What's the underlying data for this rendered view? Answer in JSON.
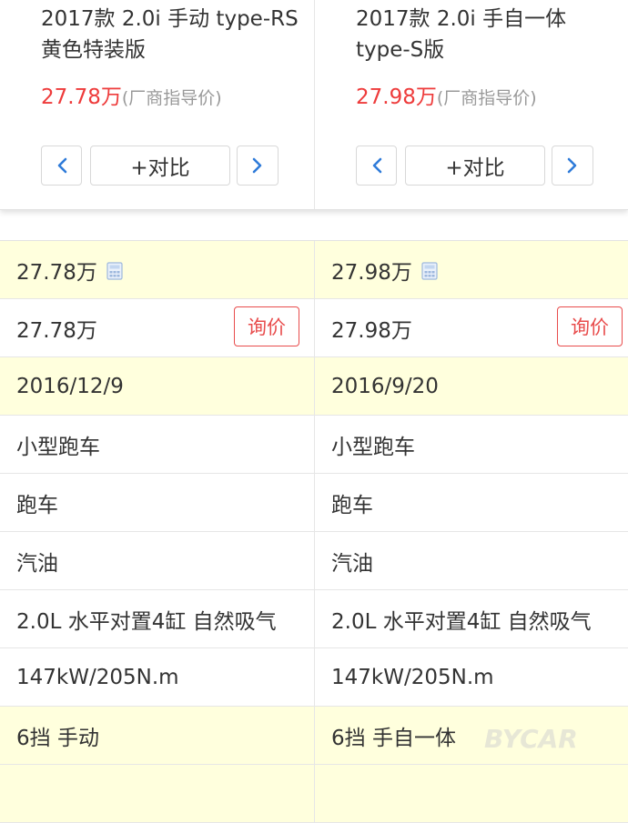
{
  "cars": [
    {
      "name": "2017款 2.0i 手动 type-RS黄色特装版",
      "price": "27.78万",
      "price_tag": "(厂商指导价)",
      "compare_label": "+对比"
    },
    {
      "name": "2017款 2.0i 手自一体 type-S版",
      "price": "27.98万",
      "price_tag": "(厂商指导价)",
      "compare_label": "+对比"
    }
  ],
  "inquiry_label": "询价",
  "rows": [
    {
      "style": "yellow",
      "values": [
        "27.78万",
        "27.98万"
      ],
      "icon": "calculator-icon"
    },
    {
      "style": "white",
      "values": [
        "27.78万",
        "27.98万"
      ],
      "action": "inquiry"
    },
    {
      "style": "yellow",
      "values": [
        "2016/12/9",
        "2016/9/20"
      ]
    },
    {
      "style": "white",
      "values": [
        "小型跑车",
        "小型跑车"
      ]
    },
    {
      "style": "white",
      "values": [
        "跑车",
        "跑车"
      ]
    },
    {
      "style": "white",
      "values": [
        "汽油",
        "汽油"
      ]
    },
    {
      "style": "white",
      "values": [
        "2.0L 水平对置4缸 自然吸气",
        "2.0L 水平对置4缸 自然吸气"
      ]
    },
    {
      "style": "white",
      "values": [
        "147kW/205N.m",
        "147kW/205N.m"
      ]
    },
    {
      "style": "yellow",
      "values": [
        "6挡 手动",
        "6挡 手自一体"
      ]
    },
    {
      "style": "yellow",
      "values": [
        "",
        ""
      ]
    }
  ],
  "colors": {
    "price": "#ee3b3b",
    "nav_arrow": "#2f7bd9",
    "row_highlight": "#ffffdd",
    "inquiry": "#e84c4c"
  },
  "watermark": "BYCAR"
}
